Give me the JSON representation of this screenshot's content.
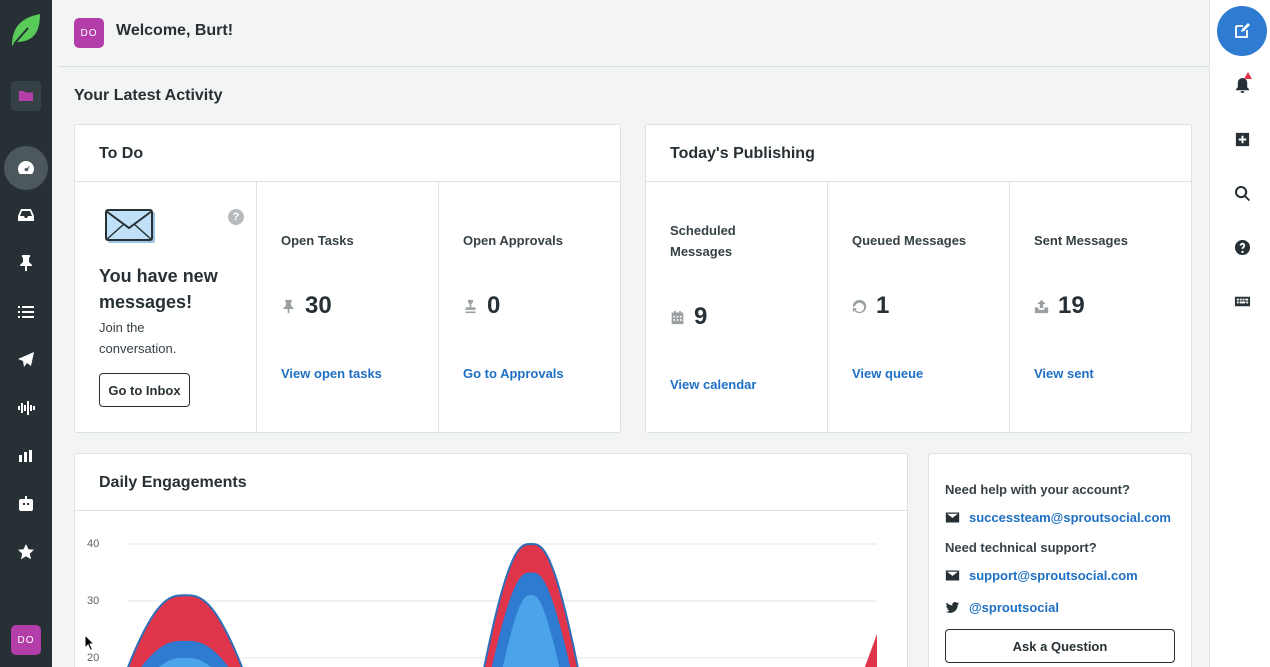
{
  "user": {
    "initials": "DO",
    "welcome": "Welcome, Burt!"
  },
  "nav": {
    "items": [
      {
        "name": "folder-icon"
      },
      {
        "name": "dashboard-icon"
      },
      {
        "name": "inbox-icon"
      },
      {
        "name": "pin-icon"
      },
      {
        "name": "list-icon"
      },
      {
        "name": "send-icon"
      },
      {
        "name": "listening-icon"
      },
      {
        "name": "reports-icon"
      },
      {
        "name": "bot-icon"
      },
      {
        "name": "star-icon"
      }
    ]
  },
  "activity": {
    "title": "Your Latest Activity"
  },
  "todo": {
    "title": "To Do",
    "new_messages": "You have new messages!",
    "join": "Join the conversation.",
    "inbox_button": "Go to Inbox",
    "help": "?",
    "open_tasks": {
      "label": "Open Tasks",
      "value": "30",
      "link": "View open tasks"
    },
    "open_approvals": {
      "label": "Open Approvals",
      "value": "0",
      "link": "Go to Approvals"
    }
  },
  "publishing": {
    "title": "Today's Publishing",
    "scheduled": {
      "label": "Scheduled Messages",
      "value": "9",
      "link": "View calendar"
    },
    "queued": {
      "label": "Queued Messages",
      "value": "1",
      "link": "View queue"
    },
    "sent": {
      "label": "Sent Messages",
      "value": "19",
      "link": "View sent"
    }
  },
  "engagements": {
    "title": "Daily Engagements"
  },
  "chart_data": {
    "type": "area",
    "title": "Daily Engagements",
    "y_ticks": [
      "40",
      "30",
      "20"
    ],
    "ylim": [
      20,
      40
    ],
    "grid": true,
    "series": [
      {
        "color": "#e0344b",
        "peaks": [
          31,
          40
        ]
      },
      {
        "color": "#2f7bd2",
        "peaks": [
          23,
          35
        ]
      },
      {
        "color": "#4ba3ea",
        "peaks": [
          20,
          31
        ]
      }
    ]
  },
  "help_panel": {
    "account_q": "Need help with your account?",
    "account_email": "successteam@sproutsocial.com",
    "tech_q": "Need technical support?",
    "tech_email": "support@sproutsocial.com",
    "twitter": "@sproutsocial",
    "ask_button": "Ask a Question"
  },
  "colors": {
    "brand_green": "#59cb59",
    "accent_blue": "#2f7bd2",
    "avatar_purple": "#b33ea9",
    "nav_dark": "#273135"
  }
}
